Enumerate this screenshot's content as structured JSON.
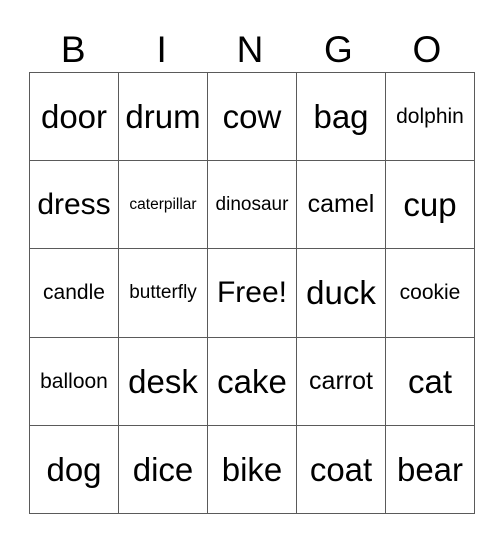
{
  "card": {
    "header": [
      "B",
      "I",
      "N",
      "G",
      "O"
    ],
    "rows": [
      [
        "door",
        "drum",
        "cow",
        "bag",
        "dolphin"
      ],
      [
        "dress",
        "caterpillar",
        "dinosaur",
        "camel",
        "cup"
      ],
      [
        "candle",
        "butterfly",
        "Free!",
        "duck",
        "cookie"
      ],
      [
        "balloon",
        "desk",
        "cake",
        "carrot",
        "cat"
      ],
      [
        "dog",
        "dice",
        "bike",
        "coat",
        "bear"
      ]
    ],
    "free_space": "Free!"
  }
}
